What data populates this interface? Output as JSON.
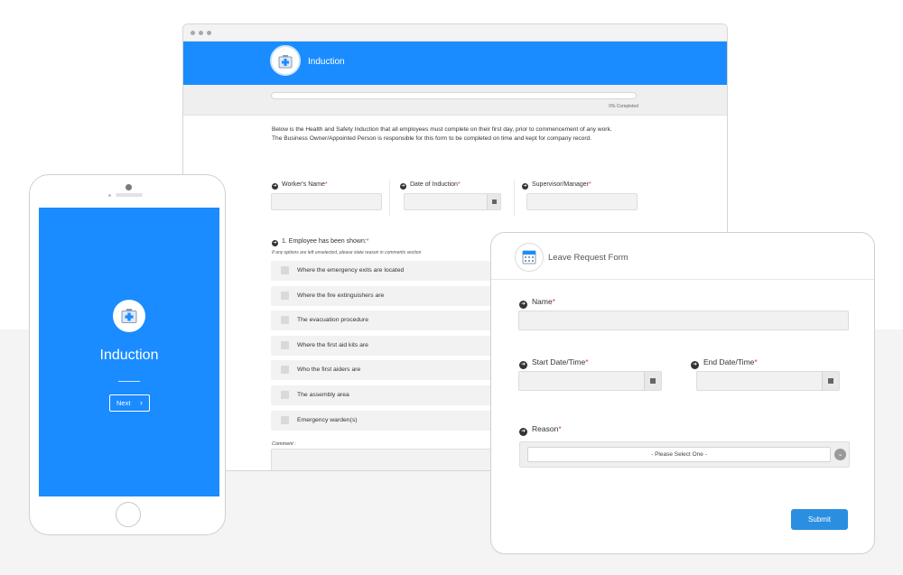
{
  "colors": {
    "brand_blue": "#1a8cff",
    "submit_blue": "#2a8fe0",
    "required": "#e23b3b"
  },
  "browser": {
    "header": {
      "title": "Induction",
      "logo_icon": "first-aid-kit-icon"
    },
    "progress": {
      "percent": 0,
      "label": "0% Completed"
    },
    "intro": [
      "Below is the Health and Safety Induction that all employees must complete on their first day, prior to commencement of any work.",
      "The Business Owner/Appointed Person is responsible for this form to be completed on time and kept for company record."
    ],
    "fields": {
      "worker_name": "Worker's Name",
      "date_of_induction": "Date of Induction",
      "supervisor": "Supervisor/Manager",
      "required_mark": "*"
    },
    "question": {
      "label": "1. Employee has been shown:",
      "note": "If any options are left unselected, please state reason in comments section",
      "options": [
        "Where the emergency exits are located",
        "Where the fire extinguishers are",
        "The evacuation procedure",
        "Where the first aid kits are",
        "Who the first aiders are",
        "The assembly area",
        "Emergency warden(s)"
      ]
    },
    "comment_label": "Comment :"
  },
  "phone": {
    "logo_icon": "first-aid-kit-icon",
    "title": "Induction",
    "next_label": "Next",
    "next_icon": "chevron-right-icon"
  },
  "leave_form": {
    "title": "Leave Request Form",
    "logo_icon": "calendar-icon",
    "name_label": "Name",
    "start_label": "Start Date/Time",
    "end_label": "End Date/Time",
    "reason_label": "Reason",
    "required_mark": "*",
    "reason_selected": "- Please Select One -",
    "submit_label": "Submit"
  }
}
